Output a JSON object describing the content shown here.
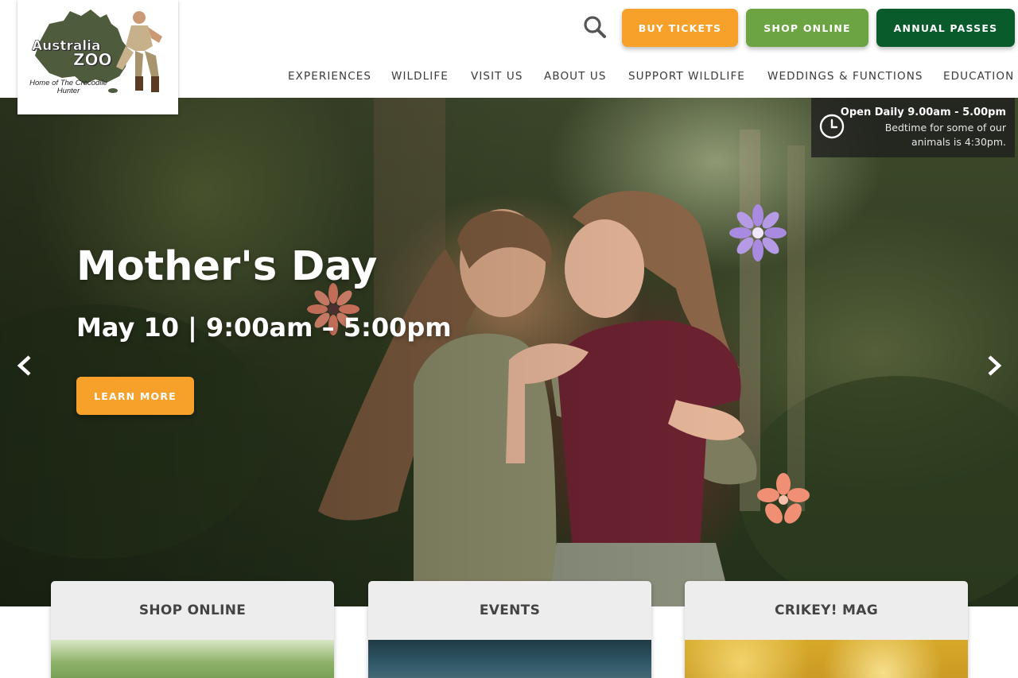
{
  "logo": {
    "name_line1": "Australia",
    "name_line2": "ZOO",
    "tagline": "Home of The Crocodile Hunter"
  },
  "header": {
    "search_icon": "search-icon",
    "buttons": {
      "tickets": "BUY TICKETS",
      "shop": "SHOP ONLINE",
      "passes": "ANNUAL PASSES"
    },
    "nav": [
      "EXPERIENCES",
      "WILDLIFE",
      "VISIT US",
      "ABOUT US",
      "SUPPORT WILDLIFE",
      "WEDDINGS & FUNCTIONS",
      "EDUCATION"
    ]
  },
  "hours": {
    "title": "Open Daily 9.00am - 5.00pm",
    "note": "Bedtime for some of our animals is 4:30pm.",
    "icon": "clock-icon"
  },
  "hero": {
    "title": "Mother's Day",
    "subtitle": "May 10 | 9:00am – 5:00pm",
    "cta": "LEARN MORE",
    "prev_icon": "chevron-left-icon",
    "next_icon": "chevron-right-icon"
  },
  "cards": [
    {
      "title": "SHOP ONLINE"
    },
    {
      "title": "EVENTS"
    },
    {
      "title": "CRIKEY! MAG"
    }
  ],
  "colors": {
    "orange": "#f7a12b",
    "green": "#6ca443",
    "dark_green": "#0a5b2c"
  }
}
